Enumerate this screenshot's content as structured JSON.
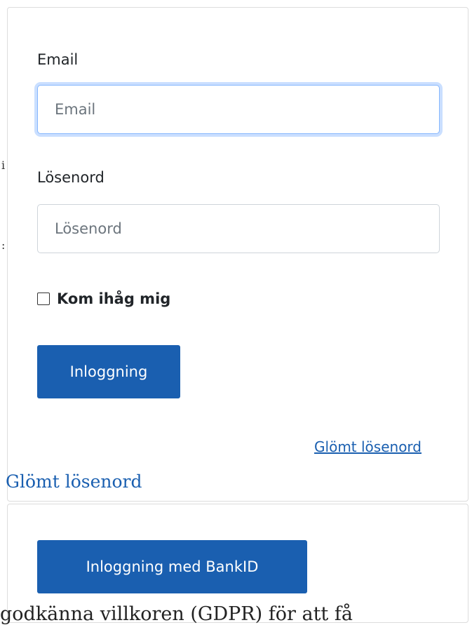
{
  "background": {
    "fragment_1": "i",
    "fragment_2": ":",
    "overlap_link": "Glömt lösenord",
    "bottom_text": "godkänna villkoren (GDPR) för att få"
  },
  "login_form": {
    "email_label": "Email",
    "email_value": "",
    "email_placeholder": "Email",
    "password_label": "Lösenord",
    "password_value": "",
    "password_placeholder": "Lösenord",
    "remember_label": "Kom ihåg mig",
    "remember_checked": false,
    "submit_label": "Inloggning",
    "forgot_label": "Glömt lösenord"
  },
  "bankid": {
    "button_label": "Inloggning med BankID"
  },
  "colors": {
    "primary": "#1a5fb0",
    "focus_border": "#86b7fe",
    "card_border": "#dcdcdc",
    "text": "#212529"
  }
}
